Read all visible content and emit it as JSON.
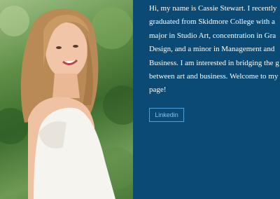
{
  "profile": {
    "photo_alt": "portrait photo",
    "bio_lines": [
      "Hi, my name is Cassie Stewart. I recently",
      "graduated from Skidmore College with a",
      "major in Studio Art, concentration in Gra",
      "Design, and a minor in Management and",
      "Business. I am interested in bridging the g",
      "between art and business. Welcome to my",
      "page!"
    ],
    "linkedin_label": "Linkedin"
  },
  "colors": {
    "panel": "#0b4a74",
    "button_border": "#4fa1d8",
    "button_text": "#7fc1ef"
  }
}
